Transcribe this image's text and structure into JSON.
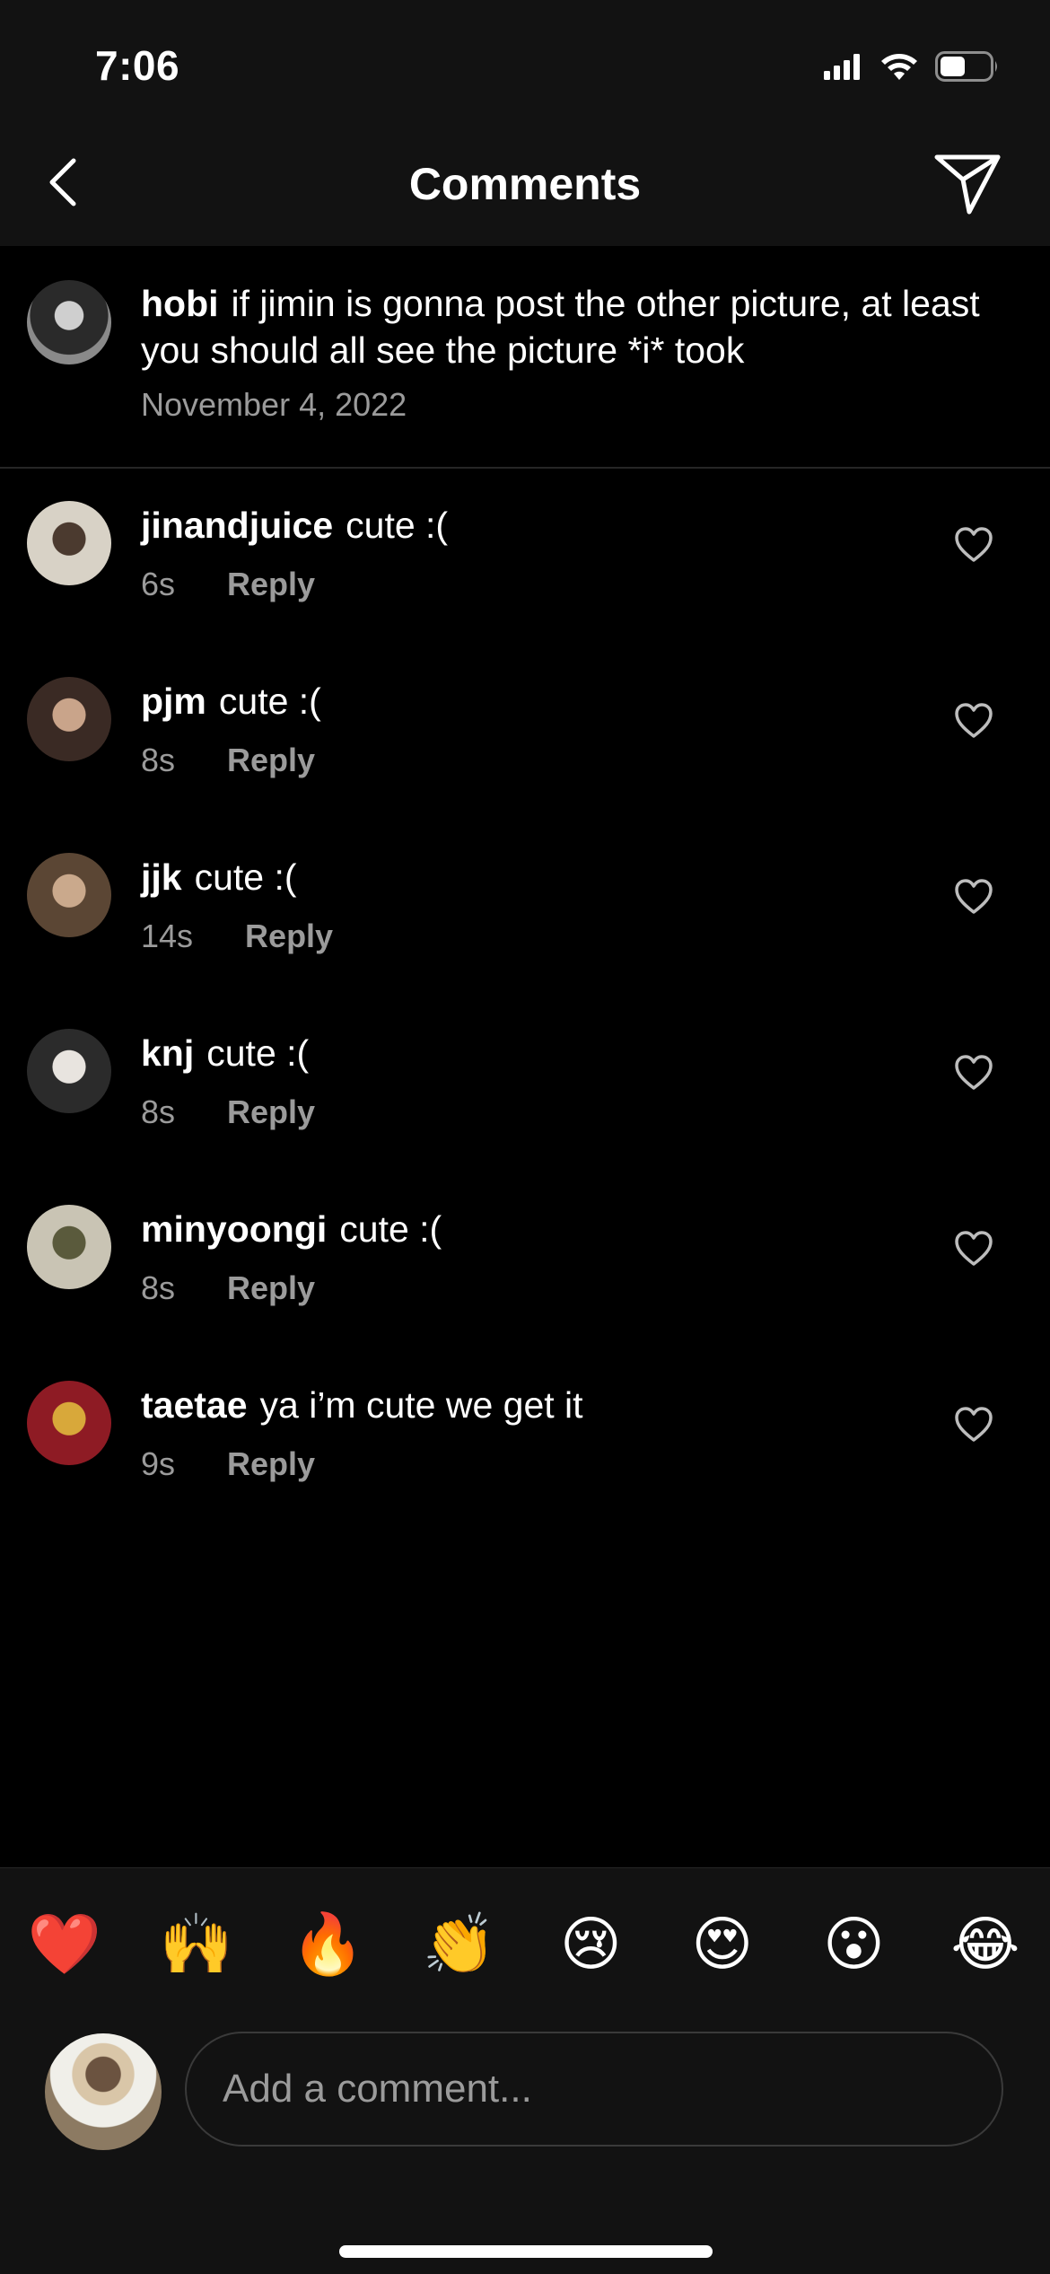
{
  "status_bar": {
    "time": "7:06"
  },
  "nav": {
    "title": "Comments"
  },
  "caption": {
    "username": "hobi",
    "text": "if jimin is gonna post the other picture, at least you should all see the picture *i* took",
    "date": "November 4, 2022"
  },
  "comments": [
    {
      "username": "jinandjuice",
      "text": "cute :(",
      "time": "6s",
      "reply_label": "Reply",
      "avatar_colors": [
        "#d8d2c6",
        "#4b3a2f"
      ]
    },
    {
      "username": "pjm",
      "text": "cute :(",
      "time": "8s",
      "reply_label": "Reply",
      "avatar_colors": [
        "#3a2a24",
        "#c9a48a"
      ]
    },
    {
      "username": "jjk",
      "text": "cute :(",
      "time": "14s",
      "reply_label": "Reply",
      "avatar_colors": [
        "#5b4634",
        "#caa98c"
      ]
    },
    {
      "username": "knj",
      "text": "cute :(",
      "time": "8s",
      "reply_label": "Reply",
      "avatar_colors": [
        "#2b2b2b",
        "#e8e4df"
      ]
    },
    {
      "username": "minyoongi",
      "text": "cute :(",
      "time": "8s",
      "reply_label": "Reply",
      "avatar_colors": [
        "#c9c4b4",
        "#5a5a3c"
      ]
    },
    {
      "username": "taetae",
      "text": "ya i’m cute we get it",
      "time": "9s",
      "reply_label": "Reply",
      "avatar_colors": [
        "#8e1b24",
        "#d8a83a"
      ]
    }
  ],
  "emoji_bar": [
    "❤️",
    "🙌",
    "🔥",
    "👏",
    "😢",
    "😍",
    "😮",
    "😂"
  ],
  "comment_box": {
    "placeholder": "Add a comment..."
  },
  "colors": {
    "background": "#000000",
    "header_background": "#121212",
    "secondary_text": "#9b9b9b",
    "heart_red": "#ed1c24"
  }
}
